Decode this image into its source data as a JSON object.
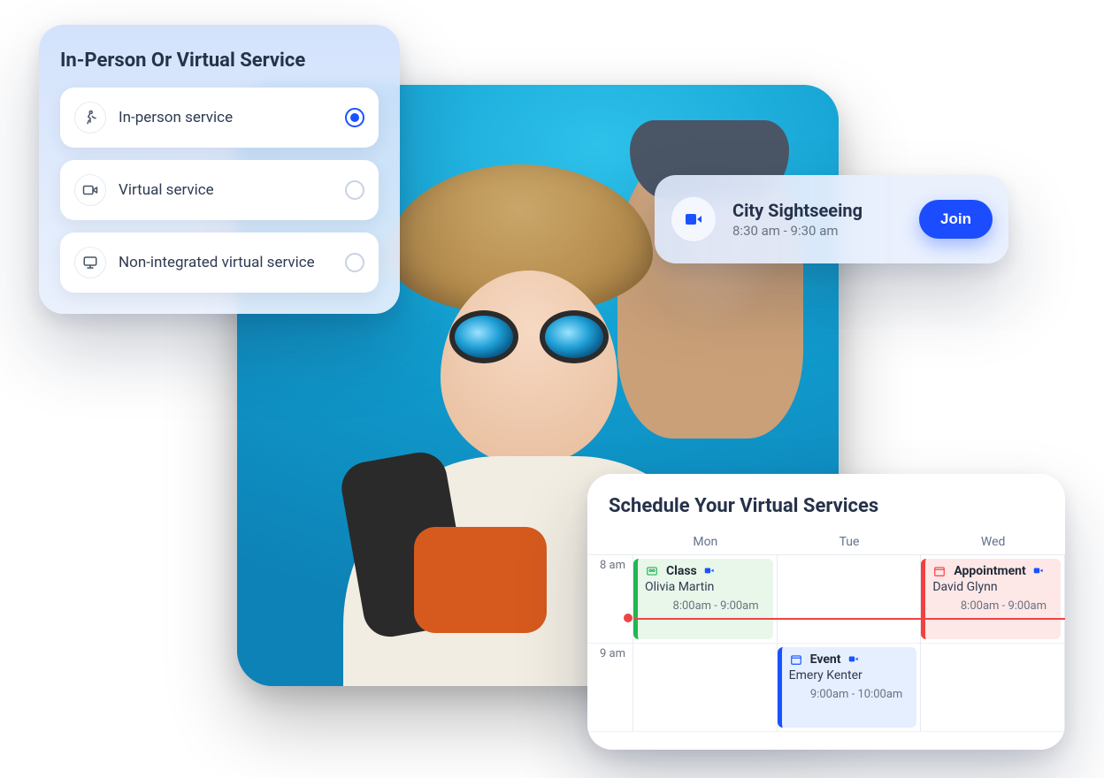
{
  "serviceCard": {
    "title": "In-Person Or Virtual Service",
    "options": [
      {
        "label": "In-person service",
        "icon": "walk-icon",
        "selected": true
      },
      {
        "label": "Virtual service",
        "icon": "video-icon",
        "selected": false
      },
      {
        "label": "Non-integrated virtual service",
        "icon": "monitor-icon",
        "selected": false
      }
    ]
  },
  "joinPill": {
    "title": "City Sightseeing",
    "time": "8:30 am - 9:30 am",
    "button": "Join"
  },
  "schedule": {
    "title": "Schedule Your Virtual Services",
    "days": [
      "Mon",
      "Tue",
      "Wed"
    ],
    "hours": [
      "8 am",
      "9 am"
    ],
    "now_row": 1,
    "events": {
      "mon8": {
        "type": "Class",
        "person": "Olivia Martin",
        "time": "8:00am - 9:00am"
      },
      "wed8": {
        "type": "Appointment",
        "person": "David Glynn",
        "time": "8:00am - 9:00am"
      },
      "tue9": {
        "type": "Event",
        "person": "Emery Kenter",
        "time": "9:00am - 10:00am"
      }
    }
  },
  "colors": {
    "primary": "#1b52ff",
    "green": "#1fb851",
    "red": "#f43f3f"
  }
}
